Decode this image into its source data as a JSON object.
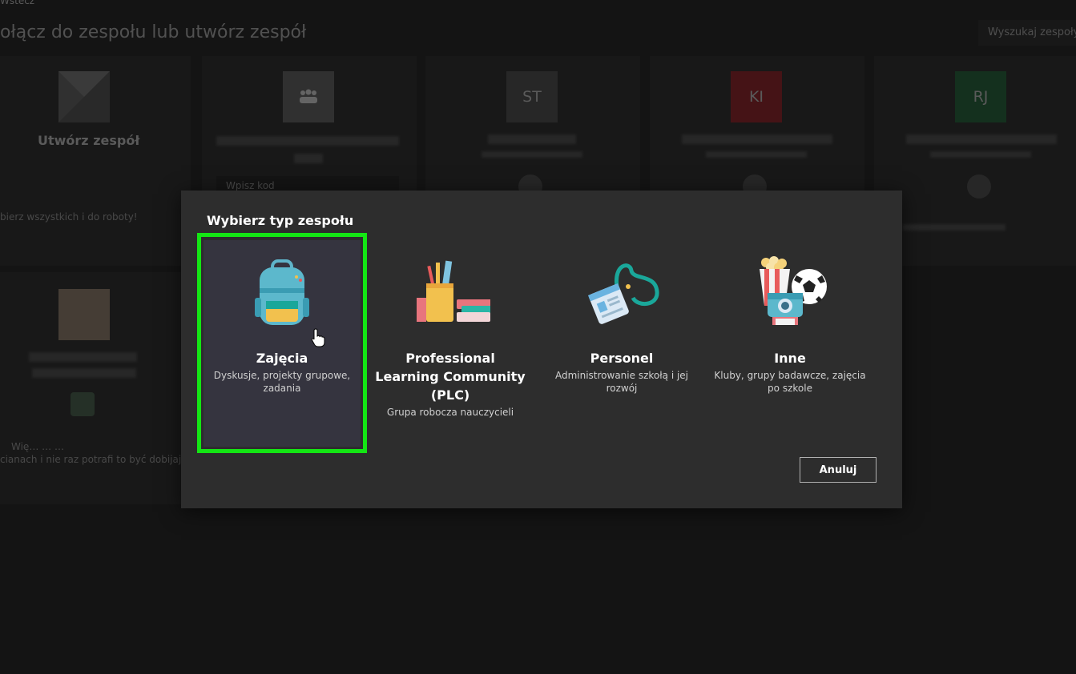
{
  "background": {
    "back_label": "Wstecz",
    "title": "ołącz do zespołu lub utwórz zespół",
    "search_placeholder": "Wyszukaj zespoły",
    "create_card": {
      "title": "Utwórz zespół",
      "desc": "bierz wszystkich i do roboty!"
    },
    "join_code_placeholder": "Wpisz kod",
    "tiles": [
      {
        "initials": "ST",
        "color": "#3d3d3d"
      },
      {
        "initials": "KI",
        "color": "#6b1e22"
      },
      {
        "initials": "RJ",
        "color": "#1f4a2e"
      }
    ],
    "lower_card_desc": [
      "Wię… … …",
      "cianach i nie raz potrafi to być dobijając..."
    ]
  },
  "dialog": {
    "title": "Wybierz typ zespołu",
    "options": [
      {
        "title": "Zajęcia",
        "desc": "Dyskusje, projekty grupowe, zadania",
        "icon": "backpack-icon"
      },
      {
        "title": "Professional Learning Community (PLC)",
        "desc": "Grupa robocza nauczycieli",
        "icon": "pencil-cup-books-icon"
      },
      {
        "title": "Personel",
        "desc": "Administrowanie szkołą i jej rozwój",
        "icon": "id-badge-icon"
      },
      {
        "title": "Inne",
        "desc": "Kluby, grupy badawcze, zajęcia po szkole",
        "icon": "popcorn-camera-ball-icon"
      }
    ],
    "cancel_label": "Anuluj",
    "highlight_color": "#14e614"
  }
}
